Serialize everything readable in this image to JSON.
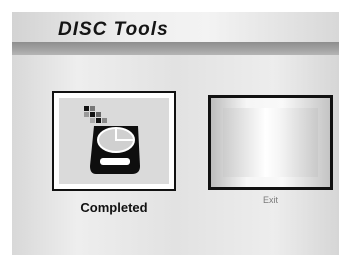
{
  "window": {
    "title": "DISC Tools"
  },
  "tiles": [
    {
      "label": "Completed",
      "icon": "disc-drive-icon"
    },
    {
      "label": "Exit",
      "icon": "none"
    }
  ]
}
